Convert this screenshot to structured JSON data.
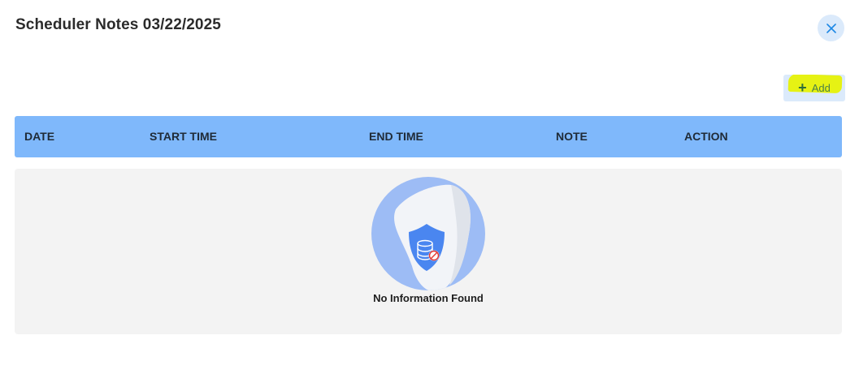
{
  "dialog": {
    "title": "Scheduler Notes 03/22/2025",
    "close_icon": "close-icon"
  },
  "toolbar": {
    "add_label": "Add",
    "add_icon": "plus-icon",
    "highlight_color": "#e6f214"
  },
  "table": {
    "header_color": "#7fb8fb",
    "columns": [
      "DATE",
      "START TIME",
      "END TIME",
      "NOTE",
      "ACTION"
    ],
    "rows": []
  },
  "empty_state": {
    "message": "No Information Found",
    "icon": "no-data-shield-icon"
  },
  "colors": {
    "accent": "#1e88e5",
    "close_bg": "#dbeafb",
    "empty_bg": "#f3f3f3"
  }
}
